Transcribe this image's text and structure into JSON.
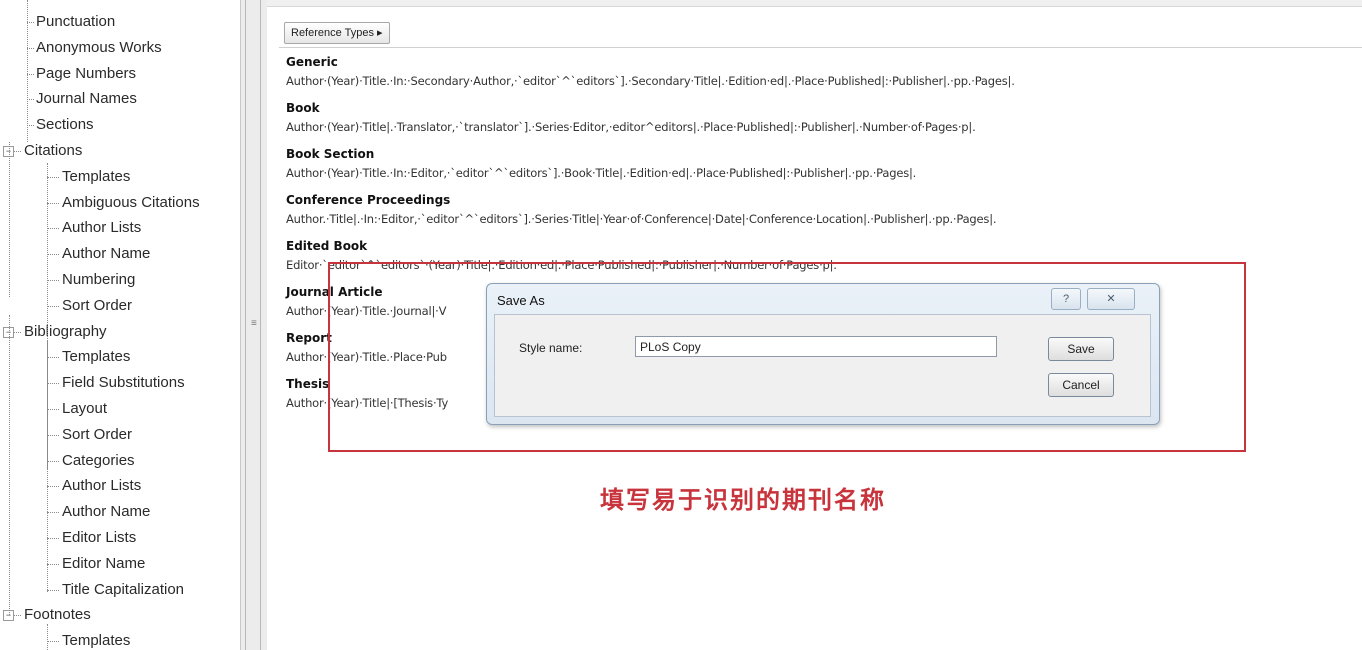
{
  "tree": {
    "items": [
      {
        "label": "Punctuation",
        "level": 1,
        "expander": ""
      },
      {
        "label": "Anonymous Works",
        "level": 1,
        "expander": ""
      },
      {
        "label": "Page Numbers",
        "level": 1,
        "expander": ""
      },
      {
        "label": "Journal Names",
        "level": 1,
        "expander": ""
      },
      {
        "label": "Sections",
        "level": 1,
        "expander": ""
      },
      {
        "label": "Citations",
        "level": 0,
        "expander": "−"
      },
      {
        "label": "Templates",
        "level": 2,
        "expander": ""
      },
      {
        "label": "Ambiguous Citations",
        "level": 2,
        "expander": ""
      },
      {
        "label": "Author Lists",
        "level": 2,
        "expander": ""
      },
      {
        "label": "Author Name",
        "level": 2,
        "expander": ""
      },
      {
        "label": "Numbering",
        "level": 2,
        "expander": ""
      },
      {
        "label": "Sort Order",
        "level": 2,
        "expander": ""
      },
      {
        "label": "Bibliography",
        "level": 0,
        "expander": "−"
      },
      {
        "label": "Templates",
        "level": 2,
        "expander": ""
      },
      {
        "label": "Field Substitutions",
        "level": 2,
        "expander": ""
      },
      {
        "label": "Layout",
        "level": 2,
        "expander": ""
      },
      {
        "label": "Sort Order",
        "level": 2,
        "expander": ""
      },
      {
        "label": "Categories",
        "level": 2,
        "expander": ""
      },
      {
        "label": "Author Lists",
        "level": 2,
        "expander": ""
      },
      {
        "label": "Author Name",
        "level": 2,
        "expander": ""
      },
      {
        "label": "Editor Lists",
        "level": 2,
        "expander": ""
      },
      {
        "label": "Editor Name",
        "level": 2,
        "expander": ""
      },
      {
        "label": "Title Capitalization",
        "level": 2,
        "expander": ""
      },
      {
        "label": "Footnotes",
        "level": 0,
        "expander": "−"
      },
      {
        "label": "Templates",
        "level": 2,
        "expander": ""
      }
    ]
  },
  "splitter": {
    "grip": "≡"
  },
  "toolbar": {
    "reference_types_label": "Reference Types ▸"
  },
  "templates": [
    {
      "title": "Generic",
      "template": "Author·(Year)·Title.·In:·Secondary·Author,·`editor`^`editors`].·Secondary·Title|.·Edition·ed|.·Place·Published|:·Publisher|.·pp.·Pages|."
    },
    {
      "title": "Book",
      "template": "Author·(Year)·Title|.·Translator,·`translator`].·Series·Editor,·editor^editors|.·Place·Published|:·Publisher|.·Number·of·Pages·p|."
    },
    {
      "title": "Book Section",
      "template": "Author·(Year)·Title.·In:·Editor,·`editor`^`editors`].·Book·Title|.·Edition·ed|.·Place·Published|:·Publisher|.·pp.·Pages|."
    },
    {
      "title": "Conference Proceedings",
      "template": "Author.·Title|.·In:·Editor,·`editor`^`editors`].·Series·Title|·Year·of·Conference|·Date|·Conference·Location|.·Publisher|.·pp.·Pages|."
    },
    {
      "title": "Edited Book",
      "template": "Editor·`editor`^`editors`·(Year)·Title|.·Edition·ed|.·Place·Published|:·Publisher|.·Number·of·Pages·p|."
    },
    {
      "title": "Journal Article",
      "template": "Author·(Year)·Title.·Journal|·V"
    },
    {
      "title": "Report",
      "template": "Author·(Year)·Title.·Place·Pub"
    },
    {
      "title": "Thesis",
      "template": "Author·(Year)·Title|·[Thesis·Ty"
    }
  ],
  "dialog": {
    "title": "Save As",
    "help_label": "?",
    "close_label": "✕",
    "style_name_label": "Style name:",
    "style_name_value": "PLoS Copy",
    "save_label": "Save",
    "cancel_label": "Cancel"
  },
  "annotation": {
    "text": "填写易于识别的期刊名称"
  },
  "colors": {
    "highlight": "#c8343c",
    "annotation": "#c8343c",
    "dialog_frame": "#dbe6f1"
  }
}
